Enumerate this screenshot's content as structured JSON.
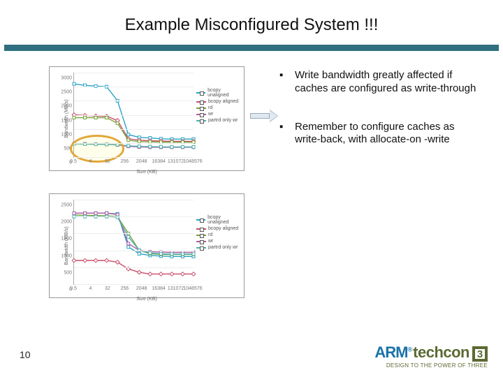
{
  "title": "Example Misconfigured System !!!",
  "page_number": "10",
  "bullets": [
    "Write bandwidth greatly affected if caches are configured as write-through",
    "Remember to configure caches as write-back, with allocate-on -write"
  ],
  "footer": {
    "brand": "ARM",
    "reg": "®",
    "conf": "techcon",
    "exp": "3",
    "tagline": "DESIGN TO THE POWER OF THREE"
  },
  "chart_data": [
    {
      "type": "line",
      "title": "",
      "xlabel": "Size (KB)",
      "ylabel": "Bandwidth (MB/s)",
      "x_ticks": [
        "0.5",
        "4",
        "32",
        "256",
        "2048",
        "16384",
        "131072",
        "1048576"
      ],
      "y_ticks": [
        "0",
        "500",
        "1000",
        "1500",
        "2000",
        "2500",
        "3000"
      ],
      "ylim": [
        0,
        3000
      ],
      "legend": [
        "bcopy unaligned",
        "bcopy aligned",
        "rd",
        "wr",
        "partrd only wr"
      ],
      "series": [
        {
          "name": "bcopy unaligned",
          "color": "#2aa3c7",
          "values": [
            2600,
            2550,
            2520,
            2500,
            2000,
            800,
            700,
            680,
            650,
            640,
            640,
            640
          ]
        },
        {
          "name": "bcopy aligned",
          "color": "#c94d6a",
          "values": [
            1500,
            1480,
            1460,
            1450,
            1300,
            650,
            600,
            580,
            570,
            560,
            560,
            560
          ]
        },
        {
          "name": "rd",
          "color": "#7aa23c",
          "values": [
            1400,
            1400,
            1400,
            1400,
            1200,
            600,
            550,
            540,
            530,
            530,
            530,
            530
          ]
        },
        {
          "name": "wr",
          "color": "#b05ba3",
          "values": [
            480,
            470,
            460,
            450,
            430,
            380,
            360,
            350,
            350,
            350,
            350,
            350
          ]
        },
        {
          "name": "partrd only wr",
          "color": "#4fb0b0",
          "values": [
            470,
            460,
            455,
            450,
            440,
            400,
            380,
            370,
            365,
            360,
            360,
            360
          ]
        }
      ],
      "annotation": {
        "type": "circle",
        "note": "low write bandwidth region"
      }
    },
    {
      "type": "line",
      "title": "",
      "xlabel": "Size (KB)",
      "ylabel": "Bandwidth (MB/s)",
      "x_ticks": [
        "0.5",
        "4",
        "32",
        "256",
        "2048",
        "16384",
        "131072",
        "1048576"
      ],
      "y_ticks": [
        "0",
        "500",
        "1000",
        "1500",
        "2000",
        "2500"
      ],
      "ylim": [
        0,
        2500
      ],
      "legend": [
        "bcopy unaligned",
        "bcopy aligned",
        "rd",
        "wr",
        "partrd only wr"
      ],
      "series": [
        {
          "name": "bcopy unaligned",
          "color": "#2aa3c7",
          "values": [
            2100,
            2100,
            2100,
            2100,
            2080,
            1100,
            900,
            850,
            830,
            820,
            820,
            820
          ]
        },
        {
          "name": "bcopy aligned",
          "color": "#c94d6a",
          "values": [
            700,
            700,
            700,
            700,
            650,
            450,
            350,
            300,
            300,
            300,
            300,
            300
          ]
        },
        {
          "name": "rd",
          "color": "#7aa23c",
          "values": [
            2050,
            2040,
            2030,
            2020,
            2000,
            1500,
            1000,
            900,
            880,
            880,
            880,
            880
          ]
        },
        {
          "name": "wr",
          "color": "#b05ba3",
          "values": [
            2100,
            2100,
            2100,
            2100,
            2060,
            1200,
            1000,
            960,
            950,
            940,
            940,
            940
          ]
        },
        {
          "name": "partrd only wr",
          "color": "#4fb0b0",
          "values": [
            2000,
            2000,
            2000,
            2000,
            1980,
            1400,
            1000,
            920,
            900,
            890,
            890,
            890
          ]
        }
      ]
    }
  ]
}
